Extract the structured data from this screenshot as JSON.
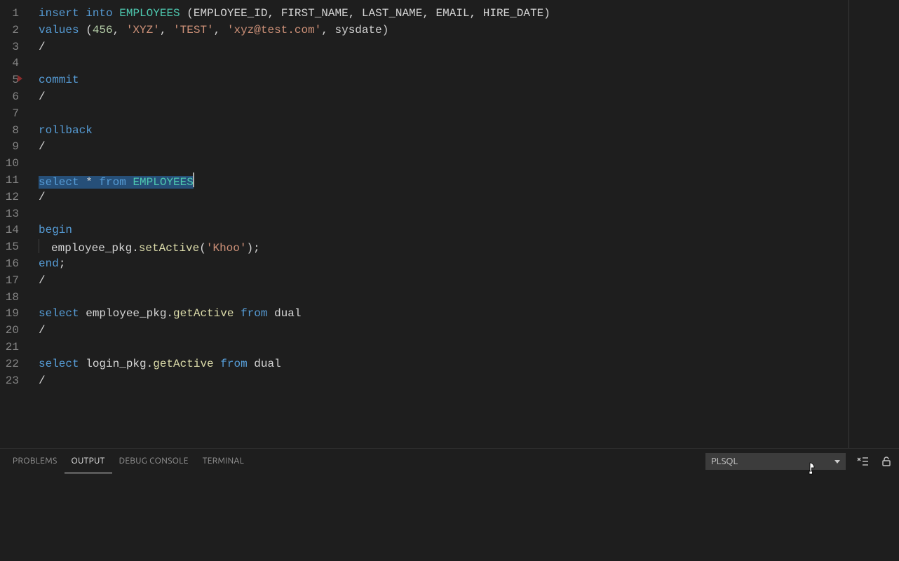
{
  "lines": {
    "count": 23,
    "1": [
      {
        "cls": "kw-blue",
        "t": "insert"
      },
      {
        "cls": "plain",
        "t": " "
      },
      {
        "cls": "kw-blue",
        "t": "into"
      },
      {
        "cls": "plain",
        "t": " "
      },
      {
        "cls": "kw-type",
        "t": "EMPLOYEES"
      },
      {
        "cls": "plain",
        "t": " ("
      },
      {
        "cls": "plain",
        "t": "EMPLOYEE_ID"
      },
      {
        "cls": "plain",
        "t": ", "
      },
      {
        "cls": "plain",
        "t": "FIRST_NAME"
      },
      {
        "cls": "plain",
        "t": ", "
      },
      {
        "cls": "plain",
        "t": "LAST_NAME"
      },
      {
        "cls": "plain",
        "t": ", "
      },
      {
        "cls": "plain",
        "t": "EMAIL"
      },
      {
        "cls": "plain",
        "t": ", "
      },
      {
        "cls": "plain",
        "t": "HIRE_DATE"
      },
      {
        "cls": "plain",
        "t": ")"
      }
    ],
    "2": [
      {
        "cls": "kw-blue",
        "t": "values"
      },
      {
        "cls": "plain",
        "t": " ("
      },
      {
        "cls": "num",
        "t": "456"
      },
      {
        "cls": "plain",
        "t": ", "
      },
      {
        "cls": "str",
        "t": "'XYZ'"
      },
      {
        "cls": "plain",
        "t": ", "
      },
      {
        "cls": "str",
        "t": "'TEST'"
      },
      {
        "cls": "plain",
        "t": ", "
      },
      {
        "cls": "str",
        "t": "'xyz@test.com'"
      },
      {
        "cls": "plain",
        "t": ", "
      },
      {
        "cls": "plain",
        "t": "sysdate"
      },
      {
        "cls": "plain",
        "t": ")"
      }
    ],
    "3": [
      {
        "cls": "plain",
        "t": "/"
      }
    ],
    "4": [],
    "5": [
      {
        "cls": "kw-blue",
        "t": "commit"
      }
    ],
    "6": [
      {
        "cls": "plain",
        "t": "/"
      }
    ],
    "7": [],
    "8": [
      {
        "cls": "kw-blue",
        "t": "rollback"
      }
    ],
    "9": [
      {
        "cls": "plain",
        "t": "/"
      }
    ],
    "10": [],
    "11": [
      {
        "cls": "kw-blue sel",
        "t": "select"
      },
      {
        "cls": "plain sel",
        "t": " * "
      },
      {
        "cls": "kw-blue sel",
        "t": "from"
      },
      {
        "cls": "plain sel",
        "t": " "
      },
      {
        "cls": "kw-type sel",
        "t": "EMPLOYEES"
      }
    ],
    "12": [
      {
        "cls": "plain",
        "t": "/"
      }
    ],
    "13": [],
    "14": [
      {
        "cls": "kw-blue",
        "t": "begin"
      }
    ],
    "15": [
      {
        "cls": "plain",
        "t": "employee_pkg."
      },
      {
        "cls": "fn",
        "t": "setActive"
      },
      {
        "cls": "plain",
        "t": "("
      },
      {
        "cls": "str",
        "t": "'Khoo'"
      },
      {
        "cls": "plain",
        "t": ");"
      }
    ],
    "16": [
      {
        "cls": "kw-blue",
        "t": "end"
      },
      {
        "cls": "plain",
        "t": ";"
      }
    ],
    "17": [
      {
        "cls": "plain",
        "t": "/"
      }
    ],
    "18": [],
    "19": [
      {
        "cls": "kw-blue",
        "t": "select"
      },
      {
        "cls": "plain",
        "t": " employee_pkg."
      },
      {
        "cls": "fn",
        "t": "getActive"
      },
      {
        "cls": "plain",
        "t": " "
      },
      {
        "cls": "kw-blue",
        "t": "from"
      },
      {
        "cls": "plain",
        "t": " "
      },
      {
        "cls": "plain",
        "t": "dual"
      }
    ],
    "20": [
      {
        "cls": "plain",
        "t": "/"
      }
    ],
    "21": [],
    "22": [
      {
        "cls": "kw-blue",
        "t": "select"
      },
      {
        "cls": "plain",
        "t": " login_pkg."
      },
      {
        "cls": "fn",
        "t": "getActive"
      },
      {
        "cls": "plain",
        "t": " "
      },
      {
        "cls": "kw-blue",
        "t": "from"
      },
      {
        "cls": "plain",
        "t": " "
      },
      {
        "cls": "plain",
        "t": "dual"
      }
    ],
    "23": [
      {
        "cls": "plain",
        "t": "/"
      }
    ]
  },
  "cursor_line": 11,
  "indent_lines": [
    15
  ],
  "panel": {
    "tabs": {
      "problems": "PROBLEMS",
      "output": "OUTPUT",
      "debug": "DEBUG CONSOLE",
      "terminal": "TERMINAL"
    },
    "active_tab": "output",
    "channel": "PLSQL"
  }
}
